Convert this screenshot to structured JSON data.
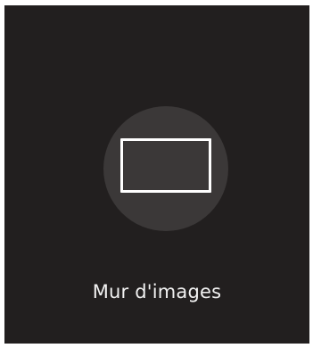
{
  "menu_item": {
    "label": "Mur d'images",
    "icon": "video-wall-icon"
  },
  "colors": {
    "background": "#221f1f",
    "icon_circle": "#3b3838",
    "icon_stroke": "#ffffff",
    "label_text": "#f2f2f2"
  }
}
